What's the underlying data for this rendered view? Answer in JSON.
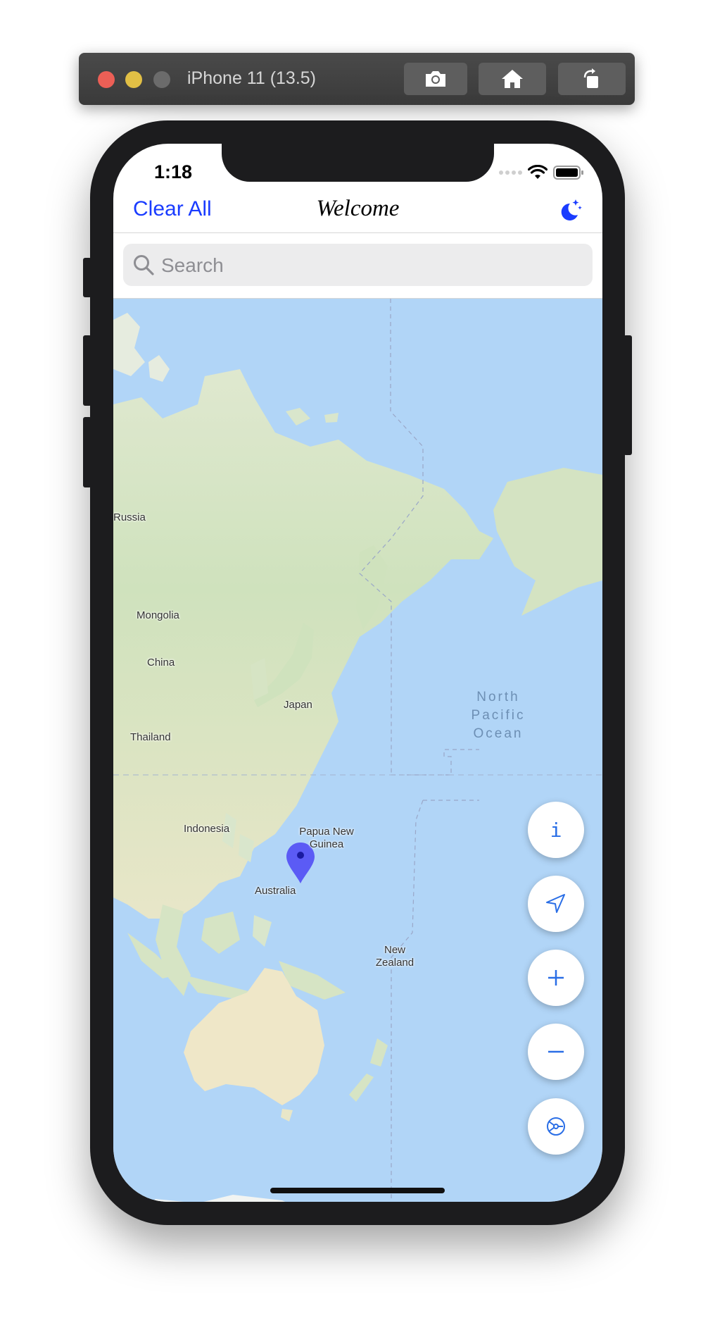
{
  "simulator": {
    "title": "iPhone 11 (13.5)",
    "buttons": [
      "screenshot-icon",
      "home-icon",
      "rotate-icon"
    ]
  },
  "status_bar": {
    "time": "1:18"
  },
  "navbar": {
    "left_button": "Clear All",
    "title": "Welcome",
    "right_icon": "moon-stars-icon",
    "accent_color": "#1a3cff"
  },
  "search": {
    "placeholder": "Search",
    "value": ""
  },
  "map": {
    "labels": {
      "russia": "Russia",
      "mongolia": "Mongolia",
      "china": "China",
      "japan": "Japan",
      "thailand": "Thailand",
      "indonesia": "Indonesia",
      "papua": "Papua New Guinea",
      "australia": "Australia",
      "new_zealand": "New Zealand",
      "ocean": "North Pacific Ocean"
    },
    "pin_color": "#5b5bf5",
    "water_color": "#b1d5f7"
  },
  "controls": {
    "info": "i",
    "icons": [
      "info-icon",
      "location-arrow-icon",
      "plus-icon",
      "minus-icon",
      "steering-wheel-icon"
    ],
    "icon_color": "#2a6ee6"
  }
}
